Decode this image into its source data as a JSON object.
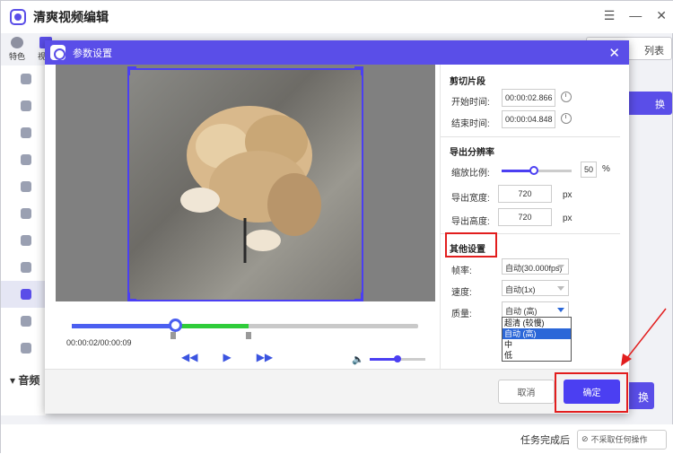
{
  "app": {
    "title": "清爽视频编辑",
    "brand_color": "#5a4ee8"
  },
  "window_controls": [
    "☰",
    "—",
    "✕"
  ],
  "topnav": {
    "items": [
      {
        "label": "特色",
        "icon": "star-icon"
      },
      {
        "label": "视频",
        "icon": "film-icon"
      }
    ]
  },
  "background": {
    "list_button": "列表",
    "convert_button": "换",
    "convert_button2": "换",
    "audio_section": "音频"
  },
  "bottom_bar": {
    "task_done_label": "任务完成后",
    "task_select_value": "不采取任何操作"
  },
  "dialog": {
    "title": "参数设置",
    "close": "✕",
    "player": {
      "time": "00:00:02/00:00:09",
      "progress_fraction": 0.3,
      "selection_start_fraction": 0.3,
      "selection_end_fraction": 0.51,
      "volume_fraction": 0.48
    },
    "clip": {
      "section_title": "剪切片段",
      "start_label": "开始时间:",
      "start_value": "00:00:02.866",
      "end_label": "结束时间:",
      "end_value": "00:00:04.848"
    },
    "resolution": {
      "section_title": "导出分辨率",
      "scale_label": "缩放比例:",
      "scale_value": "50",
      "scale_unit": "%",
      "width_label": "导出宽度:",
      "width_value": "720",
      "height_label": "导出高度:",
      "height_value": "720",
      "px_unit": "px"
    },
    "other": {
      "section_title": "其他设置",
      "framerate_label": "帧率:",
      "framerate_value": "自动(30.000fps)",
      "speed_label": "速度:",
      "speed_value": "自动(1x)",
      "quality_label": "质量:",
      "quality_value": "自动 (高)",
      "quality_options": [
        "超清 (较慢)",
        "自动 (高)",
        "中",
        "低"
      ],
      "quality_selected_index": 1
    },
    "footer": {
      "cancel": "取消",
      "ok": "确定"
    }
  },
  "annotation": {
    "highlight_color": "#e21e1e"
  }
}
